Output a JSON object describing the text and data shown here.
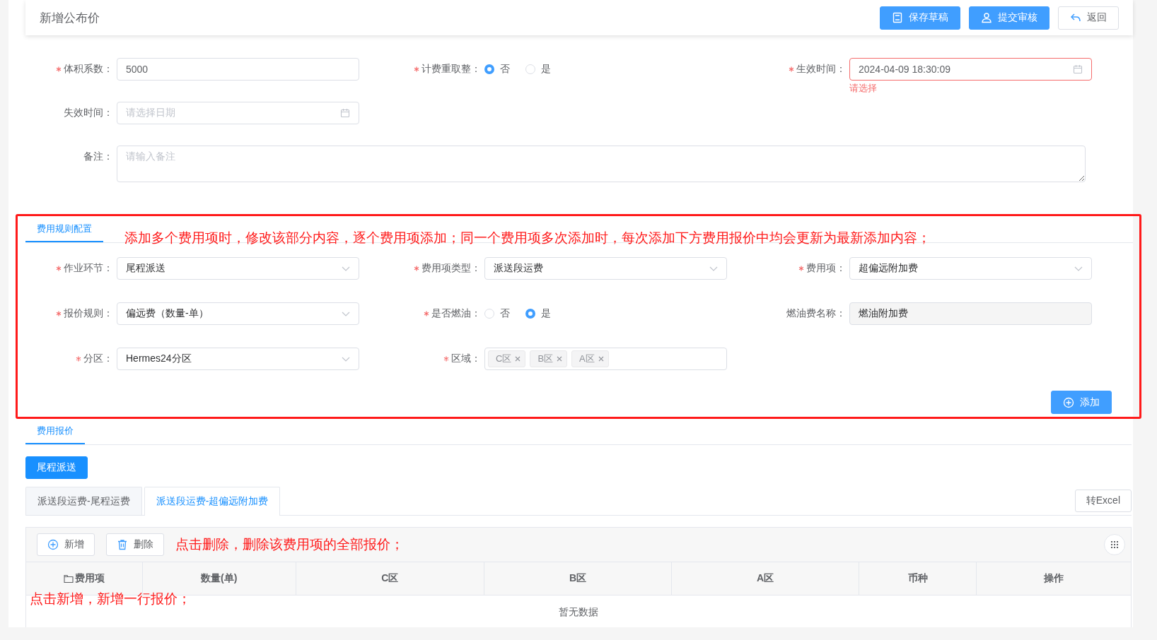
{
  "header": {
    "title": "新增公布价",
    "buttons": [
      {
        "label": "保存草稿",
        "kind": "primary"
      },
      {
        "label": "提交审核",
        "kind": "primary"
      },
      {
        "label": "返回",
        "kind": "default"
      }
    ]
  },
  "basic_form": {
    "fields": [
      {
        "kind": "input",
        "label": "体积系数：",
        "required": true,
        "value": "5000"
      },
      {
        "kind": "radio",
        "label": "计费重取整：",
        "required": true,
        "options": [
          {
            "label": "否",
            "selected": true
          },
          {
            "label": "是",
            "selected": false
          }
        ]
      },
      {
        "kind": "date",
        "label": "生效时间：",
        "required": true,
        "value": "2024-04-09 18:30:09",
        "error": "请选择"
      },
      {
        "kind": "date",
        "label": "失效时间：",
        "required": false,
        "placeholder": "请选择日期"
      },
      {
        "kind": "textarea",
        "label": "备注：",
        "required": false,
        "placeholder": "请输入备注"
      }
    ]
  },
  "fee_rules": {
    "tab": {
      "label": "费用规则配置",
      "selected": true
    },
    "annotation": "添加多个费用项时，修改该部分内容，逐个费用项添加；同一个费用项多次添加时，每次添加下方费用报价中均会更新为最新添加内容；",
    "fields": [
      {
        "kind": "select",
        "label": "作业环节：",
        "required": true,
        "value": "尾程派送"
      },
      {
        "kind": "select",
        "label": "费用项类型：",
        "required": true,
        "value": "派送段运费"
      },
      {
        "kind": "select",
        "label": "费用项：",
        "required": true,
        "value": "超偏远附加费"
      },
      {
        "kind": "select",
        "label": "报价规则：",
        "required": true,
        "value": "偏远费（数量-单）"
      },
      {
        "kind": "radio",
        "label": "是否燃油：",
        "required": true,
        "options": [
          {
            "label": "否",
            "selected": false
          },
          {
            "label": "是",
            "selected": true
          }
        ]
      },
      {
        "kind": "input",
        "label": "燃油费名称：",
        "required": false,
        "value": "燃油附加费",
        "disabled": true
      },
      {
        "kind": "select",
        "label": "分区：",
        "required": true,
        "value": "Hermes24分区"
      },
      {
        "kind": "tags",
        "label": "区域：",
        "required": true,
        "tags": [
          "C区",
          "B区",
          "A区"
        ]
      }
    ],
    "add_button": "添加"
  },
  "quote": {
    "tab": {
      "label": "费用报价",
      "selected": true
    },
    "stages": [
      {
        "label": "尾程派送",
        "selected": true
      }
    ],
    "sub_tabs": [
      {
        "label": "派送段运费-尾程运费",
        "selected": false
      },
      {
        "label": "派送段运费-超偏远附加费",
        "selected": true
      }
    ],
    "export_button": "转Excel",
    "toolbar": {
      "buttons": [
        {
          "label": "新增"
        },
        {
          "label": "删除"
        }
      ],
      "annotation": "点击删除，删除该费用项的全部报价；"
    },
    "table": {
      "columns": [
        "费用项",
        "数量(单)",
        "C区",
        "B区",
        "A区",
        "币种",
        "操作"
      ],
      "empty_text": "暂无数据",
      "annotation": "点击新增，新增一行报价；"
    }
  }
}
